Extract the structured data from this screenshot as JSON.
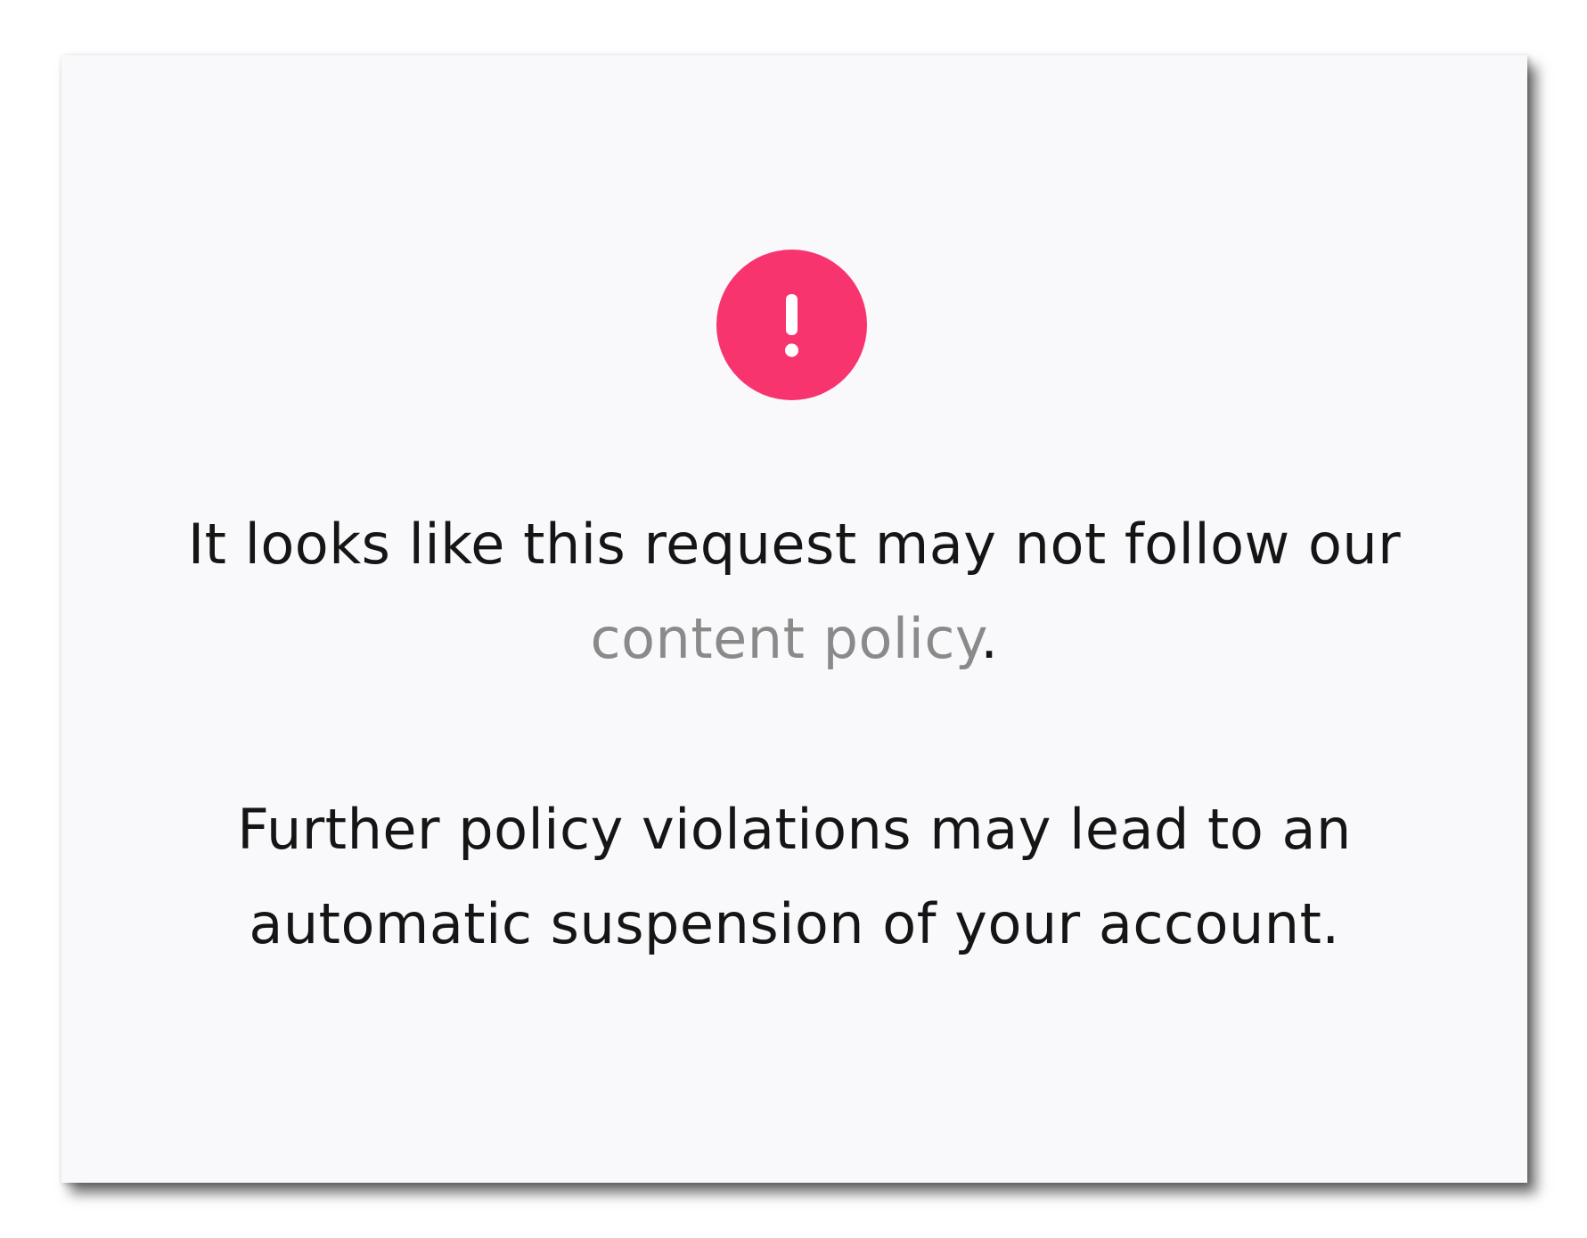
{
  "alert": {
    "icon": "exclamation-circle-icon",
    "color": "#f8346f"
  },
  "message": {
    "line1": "It looks like this request may not follow our",
    "link_text": "content policy",
    "line2_suffix": ".",
    "warning_line1": "Further policy violations may lead to an",
    "warning_line2": "automatic suspension of your account."
  },
  "colors": {
    "text": "#151515",
    "link": "#8a8a8a",
    "card_background": "#f9f9fb"
  }
}
